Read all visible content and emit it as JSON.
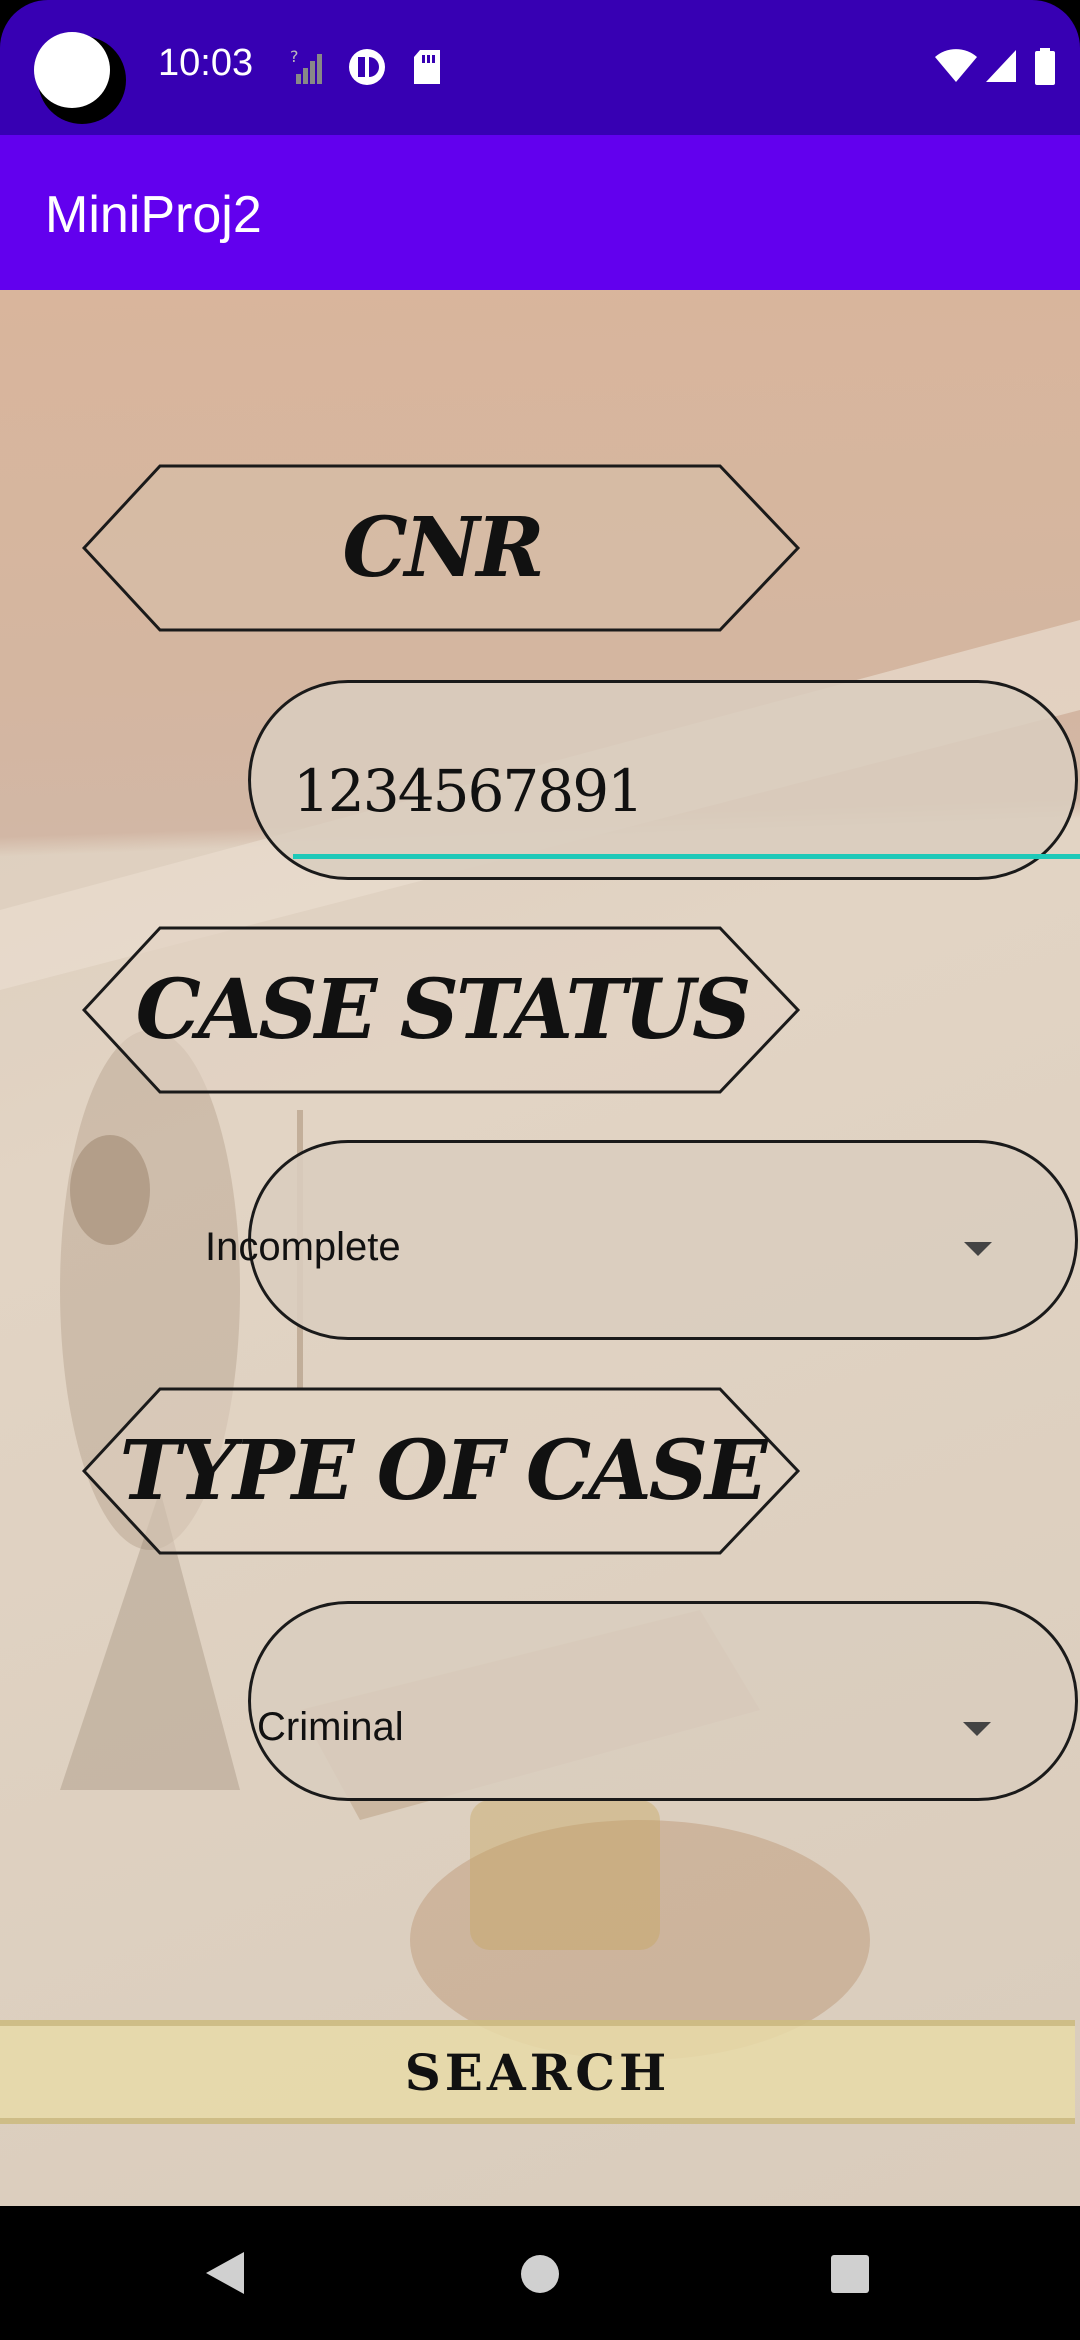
{
  "status_bar": {
    "time": "10:03",
    "icons": [
      "signal-unknown-icon",
      "data-saver-icon",
      "sd-card-icon",
      "wifi-icon",
      "cell-signal-icon",
      "battery-icon"
    ]
  },
  "app_bar": {
    "title": "MiniProj2"
  },
  "form": {
    "cnr": {
      "label": "CNR",
      "value": "1234567891"
    },
    "case_status": {
      "label": "CASE STATUS",
      "selected": "Incomplete"
    },
    "type_of_case": {
      "label": "TYPE OF CASE",
      "selected": "Criminal"
    },
    "search_label": "SEARCH"
  },
  "nav_bar": {
    "buttons": [
      "back-icon",
      "home-icon",
      "recents-icon"
    ]
  },
  "colors": {
    "status_bar": "#3700b3",
    "app_bar": "#6200ee",
    "accent_underline": "#1ec9b8"
  }
}
